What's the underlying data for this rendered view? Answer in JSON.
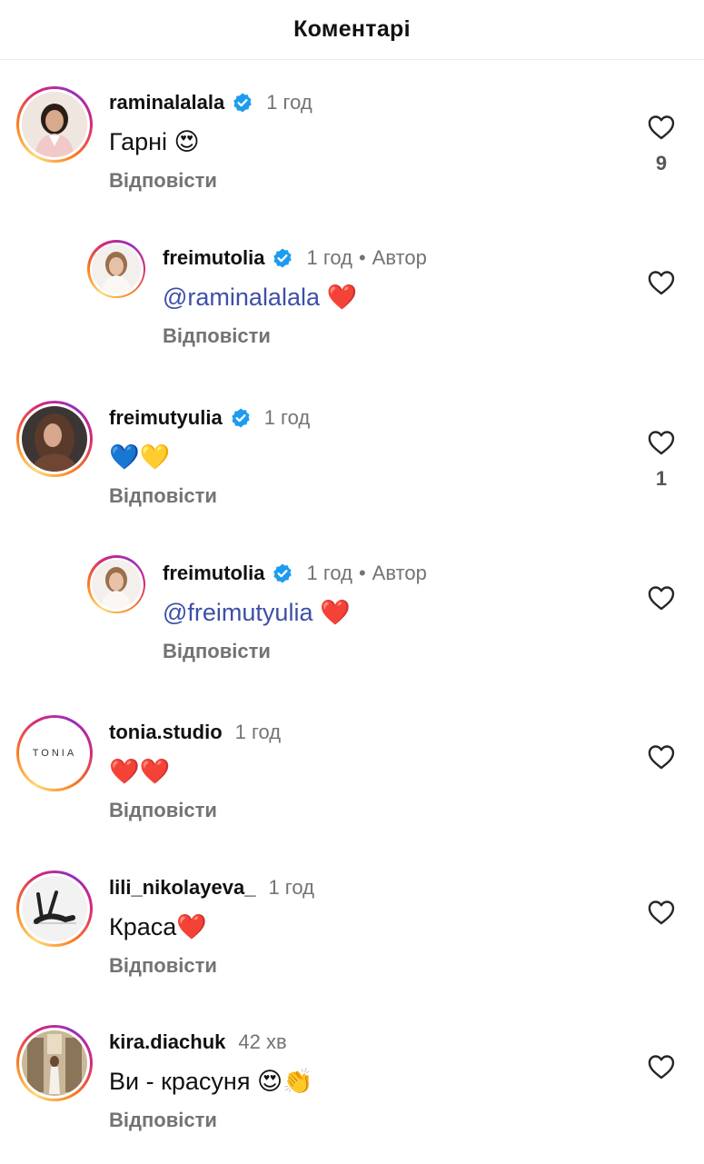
{
  "header": {
    "title": "Коментарі"
  },
  "comments": [
    {
      "username": "raminalalala",
      "verified": true,
      "time": "1 год",
      "author": "",
      "mention": "",
      "text": "Гарні 😍",
      "reply": "Відповісти",
      "likes": "9",
      "nested": false
    },
    {
      "username": "freimutolia",
      "verified": true,
      "time": "1 год",
      "author": "Автор",
      "mention": "@raminalalala",
      "text": "❤️",
      "reply": "Відповісти",
      "likes": "",
      "nested": true
    },
    {
      "username": "freimutyulia",
      "verified": true,
      "time": "1 год",
      "author": "",
      "mention": "",
      "text": "💙💛",
      "reply": "Відповісти",
      "likes": "1",
      "nested": false
    },
    {
      "username": "freimutolia",
      "verified": true,
      "time": "1 год",
      "author": "Автор",
      "mention": "@freimutyulia",
      "text": "❤️",
      "reply": "Відповісти",
      "likes": "",
      "nested": true
    },
    {
      "username": "tonia.studio",
      "verified": false,
      "time": "1 год",
      "author": "",
      "mention": "",
      "text": "❤️❤️",
      "reply": "Відповісти",
      "likes": "",
      "nested": false,
      "avatar_text": "TONIA"
    },
    {
      "username": "lili_nikolayeva_",
      "verified": false,
      "time": "1 год",
      "author": "",
      "mention": "",
      "text": "Краса❤️",
      "reply": "Відповісти",
      "likes": "",
      "nested": false
    },
    {
      "username": "kira.diachuk",
      "verified": false,
      "time": "42 хв",
      "author": "",
      "mention": "",
      "text": "Ви - красуня 😍👏",
      "reply": "Відповісти",
      "likes": "",
      "nested": false
    }
  ],
  "colors": {
    "verified": "#1d9bf0",
    "mention": "#3d4fa8",
    "secondary_text": "#737373",
    "heart": "#e3263a"
  },
  "icons": {
    "like": "heart-outline-icon",
    "verified": "verified-badge-icon"
  }
}
